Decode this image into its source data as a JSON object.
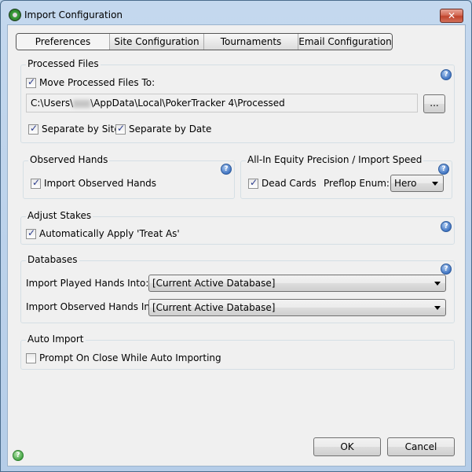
{
  "window": {
    "title": "Import Configuration",
    "close_label": "✕"
  },
  "tabs": [
    {
      "label": "Preferences",
      "active": true
    },
    {
      "label": "Site Configuration",
      "active": false
    },
    {
      "label": "Tournaments",
      "active": false
    },
    {
      "label": "Email Configuration",
      "active": false
    }
  ],
  "processed_files": {
    "title": "Processed Files",
    "move_label": "Move Processed Files To:",
    "move_checked": true,
    "path_prefix": "C:\\Users\\",
    "path_suffix": "\\AppData\\Local\\PokerTracker 4\\Processed",
    "browse_label": "...",
    "separate_site_label": "Separate by Site",
    "separate_site_checked": true,
    "separate_date_label": "Separate by Date",
    "separate_date_checked": true
  },
  "observed_hands": {
    "title": "Observed Hands",
    "import_label": "Import Observed Hands",
    "import_checked": true
  },
  "equity": {
    "title": "All-In Equity Precision / Import Speed",
    "dead_cards_label": "Dead Cards",
    "dead_cards_checked": true,
    "preflop_label": "Preflop Enum:",
    "preflop_value": "Hero"
  },
  "adjust_stakes": {
    "title": "Adjust Stakes",
    "treat_as_label": "Automatically Apply 'Treat As'",
    "treat_as_checked": true
  },
  "databases": {
    "title": "Databases",
    "played_label": "Import Played Hands Into:",
    "played_value": "[Current Active Database]",
    "observed_label": "Import Observed Hands Into:",
    "observed_value": "[Current Active Database]"
  },
  "auto_import": {
    "title": "Auto Import",
    "prompt_label": "Prompt On Close While Auto Importing",
    "prompt_checked": false
  },
  "footer": {
    "ok_label": "OK",
    "cancel_label": "Cancel"
  },
  "icons": {
    "help": "?"
  }
}
